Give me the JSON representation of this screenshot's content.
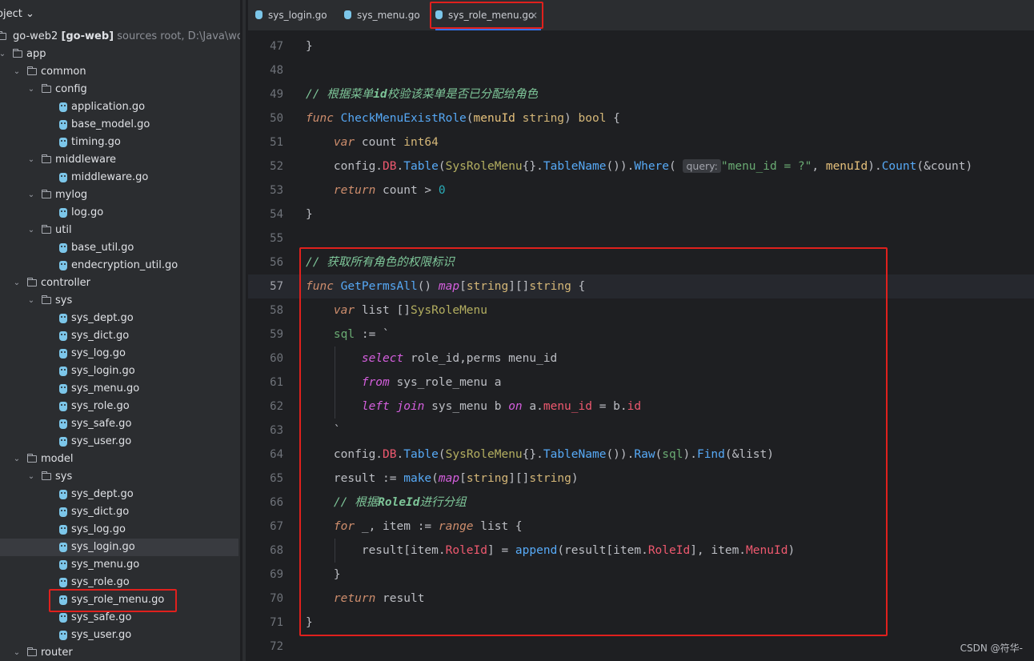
{
  "sidebar": {
    "header": "oject ⌄",
    "root": {
      "name": "go-web2",
      "module": "[go-web]",
      "meta": "sources root,  D:\\Java\\wor"
    },
    "items": [
      {
        "label": "app",
        "level": 1,
        "type": "folder"
      },
      {
        "label": "common",
        "level": 2,
        "type": "folder"
      },
      {
        "label": "config",
        "level": 3,
        "type": "folder"
      },
      {
        "label": "application.go",
        "level": 4,
        "type": "file"
      },
      {
        "label": "base_model.go",
        "level": 4,
        "type": "file"
      },
      {
        "label": "timing.go",
        "level": 4,
        "type": "file"
      },
      {
        "label": "middleware",
        "level": 3,
        "type": "folder"
      },
      {
        "label": "middleware.go",
        "level": 4,
        "type": "file"
      },
      {
        "label": "mylog",
        "level": 3,
        "type": "folder"
      },
      {
        "label": "log.go",
        "level": 4,
        "type": "file"
      },
      {
        "label": "util",
        "level": 3,
        "type": "folder"
      },
      {
        "label": "base_util.go",
        "level": 4,
        "type": "file"
      },
      {
        "label": "endecryption_util.go",
        "level": 4,
        "type": "file"
      },
      {
        "label": "controller",
        "level": 2,
        "type": "folder"
      },
      {
        "label": "sys",
        "level": 3,
        "type": "folder"
      },
      {
        "label": "sys_dept.go",
        "level": 4,
        "type": "file"
      },
      {
        "label": "sys_dict.go",
        "level": 4,
        "type": "file"
      },
      {
        "label": "sys_log.go",
        "level": 4,
        "type": "file"
      },
      {
        "label": "sys_login.go",
        "level": 4,
        "type": "file"
      },
      {
        "label": "sys_menu.go",
        "level": 4,
        "type": "file"
      },
      {
        "label": "sys_role.go",
        "level": 4,
        "type": "file"
      },
      {
        "label": "sys_safe.go",
        "level": 4,
        "type": "file"
      },
      {
        "label": "sys_user.go",
        "level": 4,
        "type": "file"
      },
      {
        "label": "model",
        "level": 2,
        "type": "folder"
      },
      {
        "label": "sys",
        "level": 3,
        "type": "folder"
      },
      {
        "label": "sys_dept.go",
        "level": 4,
        "type": "file"
      },
      {
        "label": "sys_dict.go",
        "level": 4,
        "type": "file"
      },
      {
        "label": "sys_log.go",
        "level": 4,
        "type": "file"
      },
      {
        "label": "sys_login.go",
        "level": 4,
        "type": "file",
        "selected": true
      },
      {
        "label": "sys_menu.go",
        "level": 4,
        "type": "file"
      },
      {
        "label": "sys_role.go",
        "level": 4,
        "type": "file"
      },
      {
        "label": "sys_role_menu.go",
        "level": 4,
        "type": "file",
        "highlighted": true
      },
      {
        "label": "sys_safe.go",
        "level": 4,
        "type": "file"
      },
      {
        "label": "sys_user.go",
        "level": 4,
        "type": "file"
      },
      {
        "label": "router",
        "level": 2,
        "type": "folder"
      }
    ]
  },
  "tabs": [
    {
      "label": "sys_login.go",
      "active": false
    },
    {
      "label": "sys_menu.go",
      "active": false
    },
    {
      "label": "sys_role_menu.go",
      "active": true,
      "close": "×"
    }
  ],
  "editor": {
    "current_line": 57,
    "line_numbers": [
      "47",
      "48",
      "49",
      "50",
      "51",
      "52",
      "53",
      "54",
      "55",
      "56",
      "57",
      "58",
      "59",
      "60",
      "61",
      "62",
      "63",
      "64",
      "65",
      "66",
      "67",
      "68",
      "69",
      "70",
      "71",
      "72"
    ],
    "lines": [
      {
        "t": "}"
      },
      {
        "t": ""
      },
      {
        "t": "// 根据菜单id校验该菜单是否已分配给角色"
      },
      {
        "t": "func CheckMenuExistRole(menuId string) bool {"
      },
      {
        "t": "    var count int64"
      },
      {
        "t": "    config.DB.Table(SysRoleMenu{}.TableName()).Where( query: \"menu_id = ?\", menuId).Count(&count)"
      },
      {
        "t": "    return count > 0"
      },
      {
        "t": "}"
      },
      {
        "t": ""
      },
      {
        "t": "// 获取所有角色的权限标识"
      },
      {
        "t": "func GetPermsAll() map[string][]string {"
      },
      {
        "t": "    var list []SysRoleMenu"
      },
      {
        "t": "    sql := `"
      },
      {
        "t": "        select role_id,perms menu_id"
      },
      {
        "t": "        from sys_role_menu a"
      },
      {
        "t": "        left join sys_menu b on a.menu_id = b.id"
      },
      {
        "t": "    `"
      },
      {
        "t": "    config.DB.Table(SysRoleMenu{}.TableName()).Raw(sql).Find(&list)"
      },
      {
        "t": "    result := make(map[string][]string)"
      },
      {
        "t": "    // 根据RoleId进行分组"
      },
      {
        "t": "    for _, item := range list {"
      },
      {
        "t": "        result[item.RoleId] = append(result[item.RoleId], item.MenuId)"
      },
      {
        "t": "    }"
      },
      {
        "t": "    return result"
      },
      {
        "t": "}"
      },
      {
        "t": ""
      }
    ],
    "tokens": {
      "l49a": "// 根据菜单",
      "l49b": "id",
      "l49c": "校验该菜单是否已分配给角色",
      "l50a": "func",
      "l50b": "CheckMenuExistRole",
      "l50c": "(",
      "l50d": "menuId",
      "l50e": "string",
      "l50f": ") ",
      "l50g": "bool",
      "l50h": " {",
      "l51a": "var",
      "l51b": " count ",
      "l51c": "int64",
      "l52a": "config.",
      "l52b": "DB",
      "l52c": ".",
      "l52d": "Table",
      "l52e": "(",
      "l52f": "SysRoleMenu",
      "l52g": "{}.",
      "l52h": "TableName",
      "l52i": "()).",
      "l52j": "Where",
      "l52k": "(",
      "l52l": "query:",
      "l52m": "\"menu_id = ?\"",
      "l52n": ", ",
      "l52o": "menuId",
      "l52p": ").",
      "l52q": "Count",
      "l52r": "(&count)",
      "l53a": "return",
      "l53b": " count > ",
      "l53c": "0",
      "l56a": "// 获取所有角色的权限标识",
      "l57a": "func",
      "l57b": "GetPermsAll",
      "l57c": "() ",
      "l57d": "map",
      "l57e": "[",
      "l57f": "string",
      "l57g": "][]",
      "l57h": "string",
      "l57i": " {",
      "l58a": "var",
      "l58b": " list []",
      "l58c": "SysRoleMenu",
      "l59a": "sql",
      "l59b": " := `",
      "l60a": "select",
      "l60b": " role_id,perms menu_id",
      "l61a": "from",
      "l61b": " sys_role_menu a",
      "l62a": "left join",
      "l62b": " sys_menu b ",
      "l62c": "on",
      "l62d": " a.",
      "l62e": "menu_id",
      "l62f": " = b.",
      "l62g": "id",
      "l63a": "`",
      "l64a": "config.",
      "l64b": "DB",
      "l64c": ".",
      "l64d": "Table",
      "l64e": "(",
      "l64f": "SysRoleMenu",
      "l64g": "{}.",
      "l64h": "TableName",
      "l64i": "()).",
      "l64j": "Raw",
      "l64k": "(",
      "l64l": "sql",
      "l64m": ").",
      "l64n": "Find",
      "l64o": "(&list)",
      "l65a": "result := ",
      "l65b": "make",
      "l65c": "(",
      "l65d": "map",
      "l65e": "[",
      "l65f": "string",
      "l65g": "][]",
      "l65h": "string",
      "l65i": ")",
      "l66a": "// 根据",
      "l66b": "RoleId",
      "l66c": "进行分组",
      "l67a": "for",
      "l67b": " _, item := ",
      "l67c": "range",
      "l67d": " list {",
      "l68a": "result[item.",
      "l68b": "RoleId",
      "l68c": "] = ",
      "l68d": "append",
      "l68e": "(result[item.",
      "l68f": "RoleId",
      "l68g": "], item.",
      "l68h": "MenuId",
      "l68i": ")",
      "l69a": "}",
      "l70a": "return",
      "l70b": " result",
      "l71a": "}",
      "l47a": "}",
      "l54a": "}"
    }
  },
  "watermark": "CSDN @符华-",
  "colors": {
    "highlight_box": "#e0201d",
    "accent": "#3574f0",
    "go_icon": "#7cc6e9"
  }
}
